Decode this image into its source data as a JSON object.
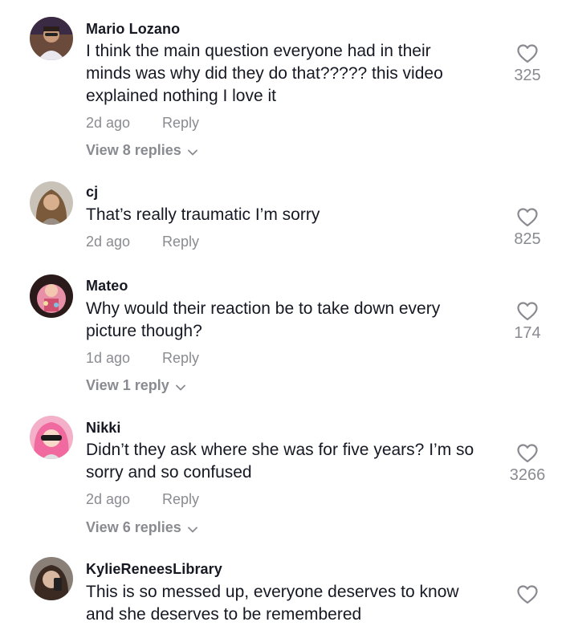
{
  "comments": [
    {
      "username": "Mario Lozano",
      "text_lines": [
        "I think the main question everyone had in their",
        "minds was why did they do that????? this video",
        "explained nothing I love it"
      ],
      "date": "2d ago",
      "reply_label": "Reply",
      "view_replies": "View 8 replies",
      "likes": "325",
      "icon": "heart-outline-icon"
    },
    {
      "username": "cj",
      "text_lines": [
        "That’s really traumatic I’m sorry"
      ],
      "date": "2d ago",
      "reply_label": "Reply",
      "likes": "825",
      "icon": "heart-outline-icon"
    },
    {
      "username": "Mateo",
      "text_lines": [
        "Why would their reaction be to take down every",
        "picture though?"
      ],
      "date": "1d ago",
      "reply_label": "Reply",
      "view_replies": "View 1 reply",
      "likes": "174",
      "icon": "heart-outline-icon"
    },
    {
      "username": "Nikki",
      "text_lines": [
        "Didn’t they ask where she was for five years? I’m so",
        "sorry and so confused"
      ],
      "date": "2d ago",
      "reply_label": "Reply",
      "view_replies": "View 6 replies",
      "likes": "3266",
      "icon": "heart-outline-icon"
    },
    {
      "username": "KylieReneesLibrary",
      "text_lines": [
        "This is so messed up, everyone deserves to know",
        "and she deserves to be remembered"
      ],
      "icon": "heart-outline-icon"
    }
  ],
  "colors": {
    "text": "#161823",
    "muted": "#8a8b91",
    "background": "#ffffff"
  }
}
